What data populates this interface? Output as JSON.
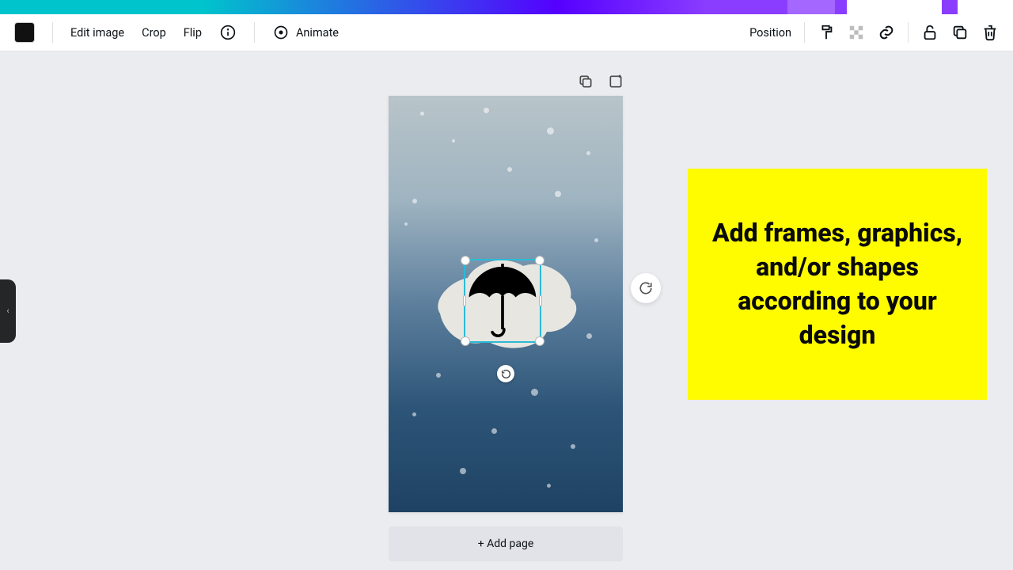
{
  "toolbar": {
    "swatch_color": "#111111",
    "edit_image": "Edit image",
    "crop": "Crop",
    "flip": "Flip",
    "animate": "Animate",
    "position": "Position"
  },
  "canvas_actions": {
    "duplicate_title": "Duplicate page",
    "add_title": "Add page"
  },
  "selection": {
    "element": "umbrella-icon"
  },
  "add_page_label": "+ Add page",
  "callout": {
    "text": "Add frames, graphics, and/or shapes according to your design"
  },
  "colors": {
    "callout_bg": "#fffc00",
    "selection_border": "#2bbad6"
  }
}
